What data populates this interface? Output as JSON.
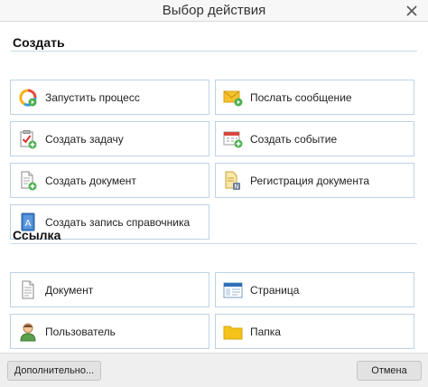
{
  "dialog": {
    "title": "Выбор действия",
    "close_icon": "close-icon"
  },
  "create": {
    "title": "Создать",
    "items": [
      {
        "label": "Запустить процесс",
        "icon": "process-icon"
      },
      {
        "label": "Послать сообщение",
        "icon": "message-icon"
      },
      {
        "label": "Создать задачу",
        "icon": "task-icon"
      },
      {
        "label": "Создать событие",
        "icon": "event-icon"
      },
      {
        "label": "Создать документ",
        "icon": "document-create-icon"
      },
      {
        "label": "Регистрация документа",
        "icon": "document-register-icon"
      },
      {
        "label": "Создать запись справочника",
        "icon": "directory-entry-icon"
      }
    ]
  },
  "link": {
    "title": "Ссылка",
    "items": [
      {
        "label": "Документ",
        "icon": "document-icon"
      },
      {
        "label": "Страница",
        "icon": "page-icon"
      },
      {
        "label": "Пользователь",
        "icon": "user-icon"
      },
      {
        "label": "Папка",
        "icon": "folder-icon"
      }
    ]
  },
  "footer": {
    "more_label": "Дополнительно...",
    "cancel_label": "Отмена"
  }
}
